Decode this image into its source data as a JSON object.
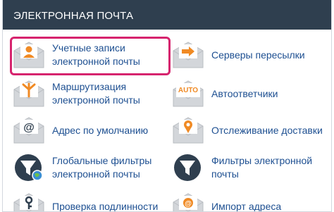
{
  "header": {
    "title": "ЭЛЕКТРОННАЯ ПОЧТА"
  },
  "items": [
    {
      "label": "Учетные записи электронной почты",
      "icon": "email-accounts-icon",
      "selected": true
    },
    {
      "label": "Серверы пересылки",
      "icon": "forwarders-icon"
    },
    {
      "label": "Маршрутизация электронной почты",
      "icon": "email-routing-icon"
    },
    {
      "label": "Автоответчики",
      "icon": "autoresponders-icon",
      "badge": "AUTO"
    },
    {
      "label": "Адрес по умолчанию",
      "icon": "default-address-icon",
      "badge": "@"
    },
    {
      "label": "Отслеживание доставки",
      "icon": "track-delivery-icon"
    },
    {
      "label": "Глобальные фильтры электронной почты",
      "icon": "global-filters-icon"
    },
    {
      "label": "Фильтры электронной почты",
      "icon": "email-filters-icon"
    },
    {
      "label": "Проверка подлинности",
      "icon": "authentication-icon"
    },
    {
      "label": "Импорт адреса",
      "icon": "address-importer-icon"
    }
  ],
  "colors": {
    "header_bg": "#2f3f4f",
    "link": "#1d4f91",
    "accent_orange": "#f08a24",
    "highlight": "#d6246e",
    "envelope": "#c5c8cc"
  }
}
